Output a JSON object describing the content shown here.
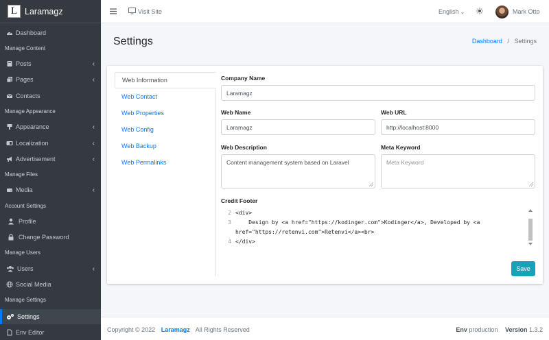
{
  "app": {
    "brand": "Laramagz",
    "logo_letter": "L"
  },
  "sidebar": {
    "dashboard": "Dashboard",
    "headers": {
      "content": "Manage Content",
      "appearance": "Manage Appearance",
      "files": "Manage Files",
      "account": "Account Settings",
      "users": "Manage Users",
      "settings": "Manage Settings"
    },
    "items": {
      "posts": "Posts",
      "pages": "Pages",
      "contacts": "Contacts",
      "appearance": "Appearance",
      "localization": "Localization",
      "advertisement": "Advertisement",
      "media": "Media",
      "profile": "Profile",
      "change_password": "Change Password",
      "users": "Users",
      "social_media": "Social Media",
      "settings": "Settings",
      "env_editor": "Env Editor"
    },
    "active_color": "#007bff"
  },
  "topbar": {
    "visit_site": "Visit Site",
    "language": "English",
    "user_name": "Mark Otto"
  },
  "page": {
    "title": "Settings",
    "breadcrumb": {
      "home": "Dashboard",
      "current": "Settings"
    }
  },
  "tabs": [
    {
      "label": "Web Information",
      "active": true
    },
    {
      "label": "Web Contact",
      "active": false
    },
    {
      "label": "Web Properties",
      "active": false
    },
    {
      "label": "Web Config",
      "active": false
    },
    {
      "label": "Web Backup",
      "active": false
    },
    {
      "label": "Web Permalinks",
      "active": false
    }
  ],
  "form": {
    "company_name": {
      "label": "Company Name",
      "value": "Laramagz"
    },
    "web_name": {
      "label": "Web Name",
      "value": "Laramagz"
    },
    "web_url": {
      "label": "Web URL",
      "value": "http://localhost:8000"
    },
    "web_description": {
      "label": "Web Description",
      "value": "Content management system based on Laravel"
    },
    "meta_keyword": {
      "label": "Meta Keyword",
      "value": "",
      "placeholder": "Meta Keyword"
    },
    "credit_footer": {
      "label": "Credit Footer",
      "lines": [
        {
          "n": "2",
          "text": "<div>"
        },
        {
          "n": "3",
          "text": "    Design by <a href=\"https://kodinger.com\">Kodinger</a>, Developed by <a"
        },
        {
          "n": "",
          "text": "href=\"https://retenvi.com\">Retenvi</a><br>"
        },
        {
          "n": "4",
          "text": "</div>"
        }
      ]
    },
    "save_label": "Save",
    "save_color": "#17a2b8"
  },
  "footer": {
    "copyright": "Copyright © 2022",
    "brand": "Laramagz",
    "rights": "All Rights Reserved",
    "env_label": "Env",
    "env_value": "production",
    "version_label": "Version",
    "version_value": "1.3.2"
  }
}
